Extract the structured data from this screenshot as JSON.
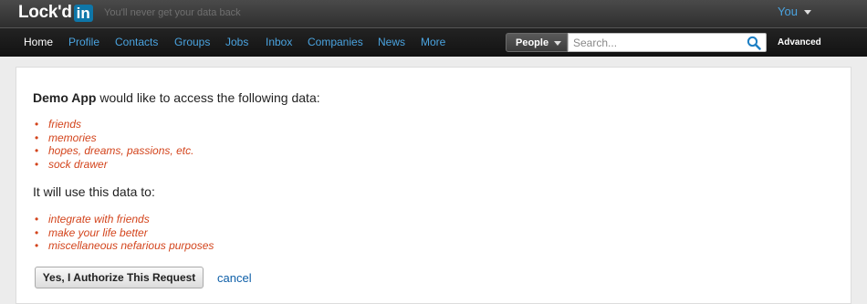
{
  "brand": {
    "logo_text": "Lock'd",
    "logo_badge": "in",
    "tagline": "You'll never get your data back"
  },
  "header": {
    "user_menu_label": "You"
  },
  "nav": {
    "items": [
      {
        "label": "Home"
      },
      {
        "label": "Profile"
      },
      {
        "label": "Contacts"
      },
      {
        "label": "Groups"
      },
      {
        "label": "Jobs"
      },
      {
        "label": "Inbox"
      },
      {
        "label": "Companies"
      },
      {
        "label": "News"
      },
      {
        "label": "More"
      }
    ],
    "active": "Home"
  },
  "search": {
    "scope_label": "People",
    "placeholder": "Search...",
    "value": "",
    "advanced_label": "Advanced"
  },
  "consent": {
    "app_name": "Demo App",
    "intro_suffix": " would like to access the following data:",
    "data_items": [
      "friends",
      "memories",
      "hopes, dreams, passions, etc.",
      "sock drawer"
    ],
    "use_heading": "It will use this data to:",
    "use_items": [
      "integrate with friends",
      "make your life better",
      "miscellaneous nefarious purposes"
    ],
    "authorize_label": "Yes, I Authorize This Request",
    "cancel_label": "cancel"
  },
  "colors": {
    "accent": "#4aa3df",
    "brand_blue": "#0e76a8",
    "list_red": "#d3441c",
    "link_blue": "#0e5fa8"
  },
  "icons": {
    "search": "search-icon",
    "dropdown": "chevron-down-icon"
  }
}
